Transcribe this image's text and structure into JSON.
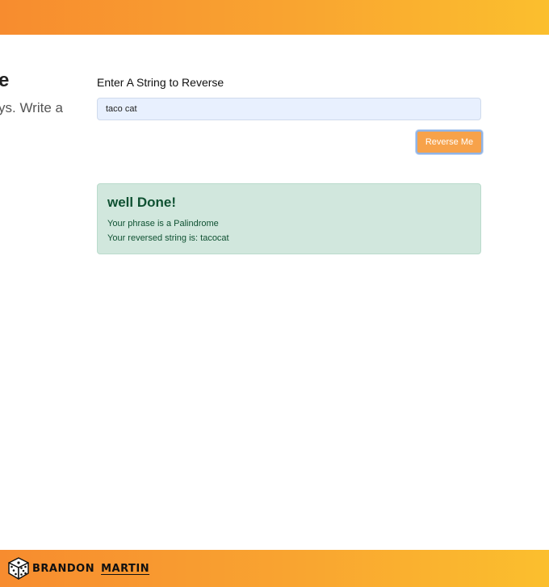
{
  "sidebar": {
    "title_fragment": "e",
    "description_fragment": "ys. Write a"
  },
  "form": {
    "label": "Enter A String to Reverse",
    "input_value": "taco cat",
    "button_label": "Reverse Me"
  },
  "result": {
    "heading": "well Done!",
    "line1": "Your phrase is a Palindrome",
    "line2": "Your reversed string is: tacocat"
  },
  "footer": {
    "brand_first": "BRANDON",
    "brand_last": "MARTIN",
    "logo_icon": "dice-icon"
  },
  "colors": {
    "accent_start": "#f78c2f",
    "accent_end": "#fbbf2e",
    "button": "#f7a24a",
    "success_bg": "#d1e7dd",
    "success_text": "#0f5132"
  }
}
